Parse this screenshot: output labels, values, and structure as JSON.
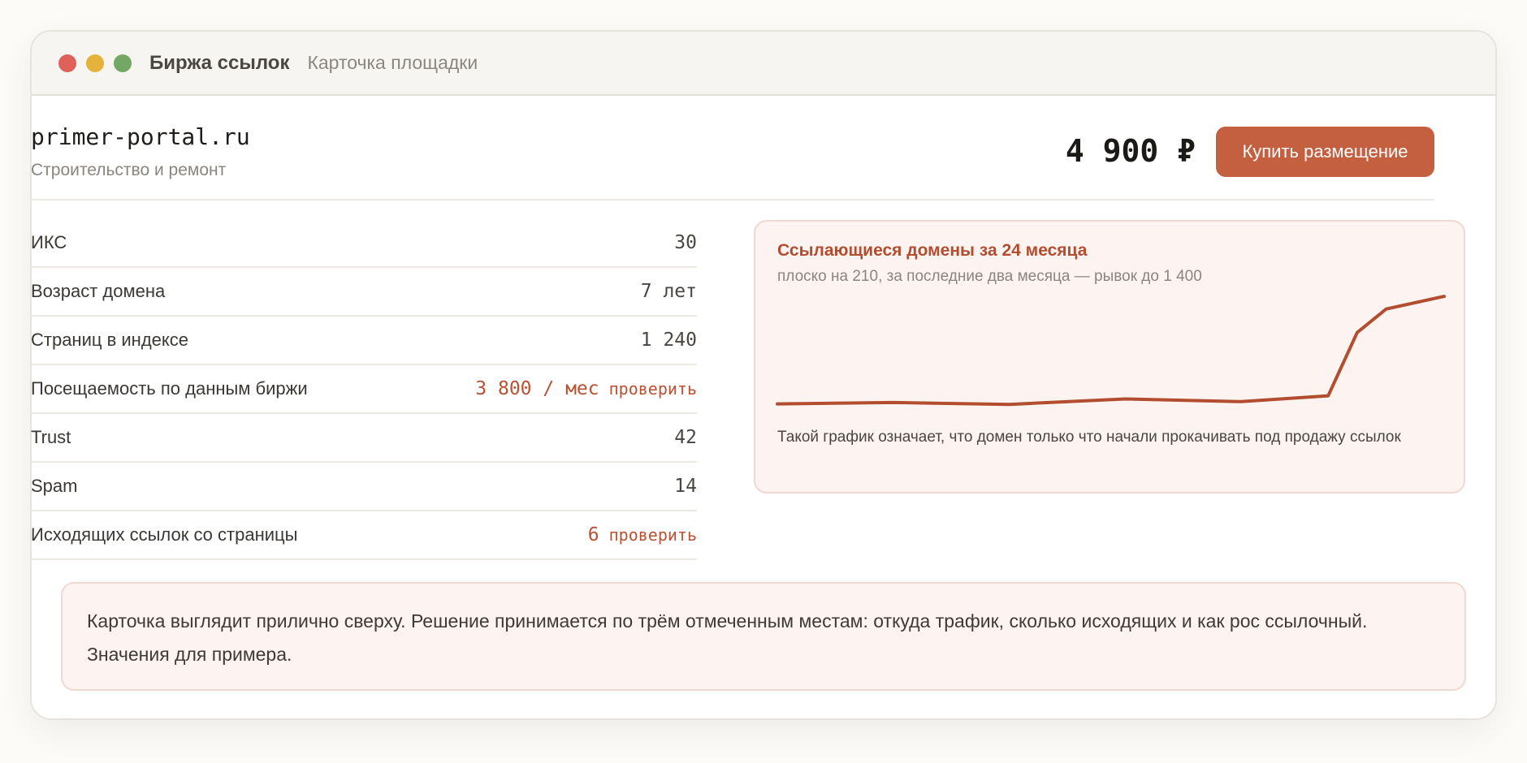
{
  "window": {
    "app_title": "Биржа ссылок",
    "subtitle": "Карточка площадки"
  },
  "site": {
    "domain": "primer-portal.ru",
    "category": "Строительство и ремонт",
    "price": "4 900 ₽",
    "buy_label": "Купить размещение"
  },
  "metrics": [
    {
      "label": "ИКС",
      "value": "30",
      "flag": false,
      "link": ""
    },
    {
      "label": "Возраст домена",
      "value": "7 лет",
      "flag": false,
      "link": ""
    },
    {
      "label": "Страниц в индексе",
      "value": "1 240",
      "flag": false,
      "link": ""
    },
    {
      "label": "Посещаемость по данным биржи",
      "value": "3 800 / мес",
      "flag": true,
      "link": "проверить"
    },
    {
      "label": "Trust",
      "value": "42",
      "flag": false,
      "link": ""
    },
    {
      "label": "Spam",
      "value": "14",
      "flag": false,
      "link": ""
    },
    {
      "label": "Исходящих ссылок со страницы",
      "value": "6",
      "flag": true,
      "link": "проверить"
    }
  ],
  "chart_card": {
    "title": "Ссылающиеся домены за 24 месяца",
    "subtitle": "плоско на 210, за последние два месяца — рывок до 1 400",
    "note": "Такой график означает, что домен только что начали прокачивать под продажу ссылок"
  },
  "chart_data": {
    "type": "line",
    "title": "Ссылающиеся домены за 24 месяца",
    "subtitle": "плоско на 210, за последние два месяца — рывок до 1 400",
    "xlabel": "",
    "ylabel": "",
    "x": [
      1,
      5,
      9,
      13,
      17,
      20,
      21,
      22,
      24
    ],
    "values": [
      210,
      225,
      205,
      265,
      235,
      300,
      1000,
      1260,
      1400
    ],
    "ylim": [
      0,
      1500
    ],
    "grid": false,
    "color": "#b24d2f"
  },
  "summary": "Карточка выглядит прилично сверху. Решение принимается по трём отмеченным местам: откуда трафик, сколько исходящих и как рос ссылочный. Значения для примера.",
  "colors": {
    "accent": "#c45f3f",
    "flag": "#b95233",
    "close": "#e0605a",
    "minimize": "#e5b23b",
    "maximize": "#72a863"
  }
}
